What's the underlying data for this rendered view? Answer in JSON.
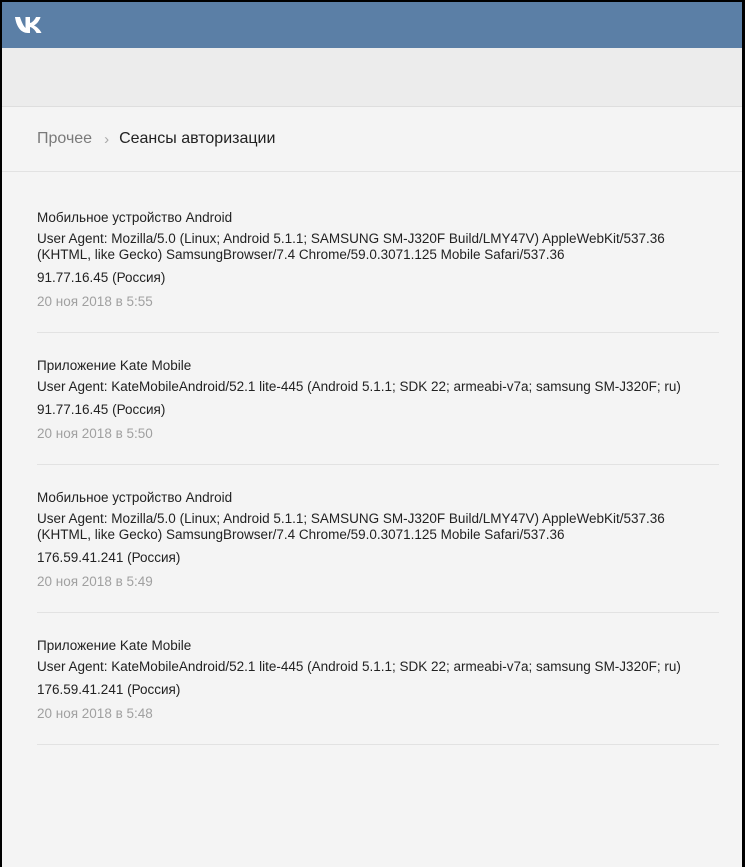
{
  "header": {
    "logo_icon": "vk-logo-icon",
    "bar_color": "#5b7fa6"
  },
  "breadcrumb": {
    "parent": "Прочее",
    "separator": "›",
    "current": "Сеансы авторизации"
  },
  "sessions": [
    {
      "title": "Мобильное устройство Android",
      "user_agent": "User Agent: Mozilla/5.0 (Linux; Android 5.1.1; SAMSUNG SM-J320F Build/LMY47V) AppleWebKit/537.36 (KHTML, like Gecko) SamsungBrowser/7.4 Chrome/59.0.3071.125 Mobile Safari/537.36",
      "ip": "91.77.16.45 (Россия)",
      "date": "20 ноя 2018 в 5:55"
    },
    {
      "title": "Приложение Kate Mobile",
      "user_agent": "User Agent: KateMobileAndroid/52.1 lite-445 (Android 5.1.1; SDK 22; armeabi-v7a; samsung SM-J320F; ru)",
      "ip": "91.77.16.45 (Россия)",
      "date": "20 ноя 2018 в 5:50"
    },
    {
      "title": "Мобильное устройство Android",
      "user_agent": "User Agent: Mozilla/5.0 (Linux; Android 5.1.1; SAMSUNG SM-J320F Build/LMY47V) AppleWebKit/537.36 (KHTML, like Gecko) SamsungBrowser/7.4 Chrome/59.0.3071.125 Mobile Safari/537.36",
      "ip": "176.59.41.241 (Россия)",
      "date": "20 ноя 2018 в 5:49"
    },
    {
      "title": "Приложение Kate Mobile",
      "user_agent": "User Agent: KateMobileAndroid/52.1 lite-445 (Android 5.1.1; SDK 22; armeabi-v7a; samsung SM-J320F; ru)",
      "ip": "176.59.41.241 (Россия)",
      "date": "20 ноя 2018 в 5:48"
    }
  ]
}
